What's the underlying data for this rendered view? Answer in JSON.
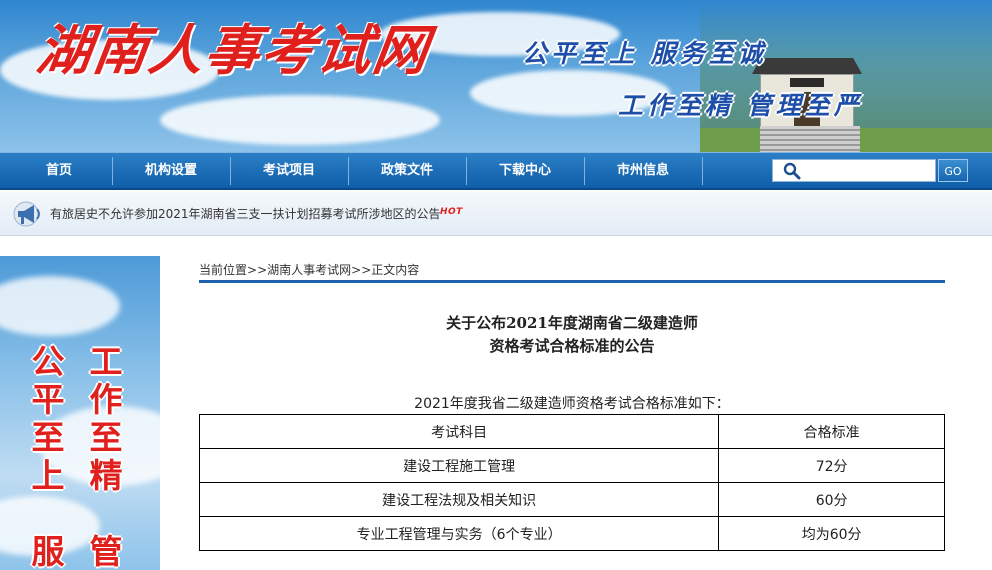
{
  "header": {
    "logo_text": "湖南人事考试网",
    "slogan_line1": "公平至上  服务至诚",
    "slogan_line2": "工作至精  管理至严"
  },
  "nav": {
    "items": [
      {
        "label": "首页"
      },
      {
        "label": "机构设置"
      },
      {
        "label": "考试项目"
      },
      {
        "label": "政策文件"
      },
      {
        "label": "下载中心"
      },
      {
        "label": "市州信息"
      }
    ],
    "search": {
      "placeholder": "",
      "value": ""
    },
    "go_label": "GO"
  },
  "notice": {
    "text": "有旅居史不允许参加2021年湖南省三支一扶计划招募考试所涉地区的公告",
    "badge": "HOT"
  },
  "side_banner": {
    "left_column": [
      "公",
      "平",
      "至",
      "上",
      "",
      "服"
    ],
    "right_column": [
      "工",
      "作",
      "至",
      "精",
      "",
      "管"
    ]
  },
  "breadcrumb": {
    "label": "当前位置",
    "sep1": ">>",
    "site": "湖南人事考试网",
    "sep2": ">>",
    "current": "正文内容"
  },
  "article": {
    "title_line1": "关于公布2021年度湖南省二级建造师",
    "title_line2": "资格考试合格标准的公告",
    "intro": "2021年度我省二级建造师资格考试合格标准如下：",
    "table": {
      "headers": [
        "考试科目",
        "合格标准"
      ],
      "rows": [
        [
          "建设工程施工管理",
          "72分"
        ],
        [
          "建设工程法规及相关知识",
          "60分"
        ],
        [
          "专业工程管理与实务（6个专业）",
          "均为60分"
        ]
      ]
    }
  },
  "colors": {
    "nav_blue": "#1565b0",
    "logo_red": "#e0201c",
    "slogan_blue": "#1e4fa8",
    "breadcrumb_rule": "#1f5fae"
  }
}
